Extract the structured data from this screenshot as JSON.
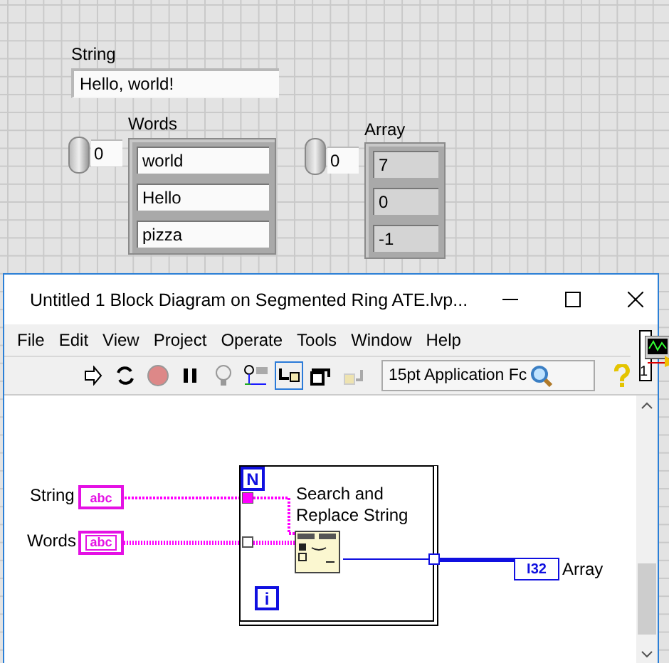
{
  "front_panel": {
    "string_control": {
      "label": "String",
      "value": "Hello, world!"
    },
    "words_array": {
      "label": "Words",
      "index": "0",
      "elements": [
        "world",
        "Hello",
        "pizza"
      ]
    },
    "array_indicator": {
      "label": "Array",
      "index": "0",
      "elements": [
        "7",
        "0",
        "-1"
      ]
    }
  },
  "window": {
    "title": "Untitled 1 Block Diagram on Segmented Ring ATE.lvp...",
    "menu": [
      "File",
      "Edit",
      "View",
      "Project",
      "Operate",
      "Tools",
      "Window",
      "Help"
    ],
    "toolbar": {
      "buttons": [
        {
          "kind": "run",
          "selected": false
        },
        {
          "kind": "run-continuously",
          "selected": false
        },
        {
          "kind": "abort",
          "selected": false
        },
        {
          "kind": "pause",
          "selected": false
        },
        {
          "kind": "highlight",
          "selected": false
        },
        {
          "kind": "retain",
          "selected": false
        },
        {
          "kind": "step-into",
          "selected": true
        },
        {
          "kind": "step-over",
          "selected": false
        },
        {
          "kind": "step-out",
          "selected": false
        }
      ],
      "font": "15pt Application Fc"
    },
    "connector_number": "1"
  },
  "diagram": {
    "terminals": [
      {
        "label": "String",
        "type": "abc",
        "array": false
      },
      {
        "label": "Words",
        "type": "abc",
        "array": true
      }
    ],
    "loop_count": "N",
    "loop_index": "i",
    "function_label": "Search and Replace String",
    "output": {
      "label": "Array",
      "type": "I32"
    }
  }
}
